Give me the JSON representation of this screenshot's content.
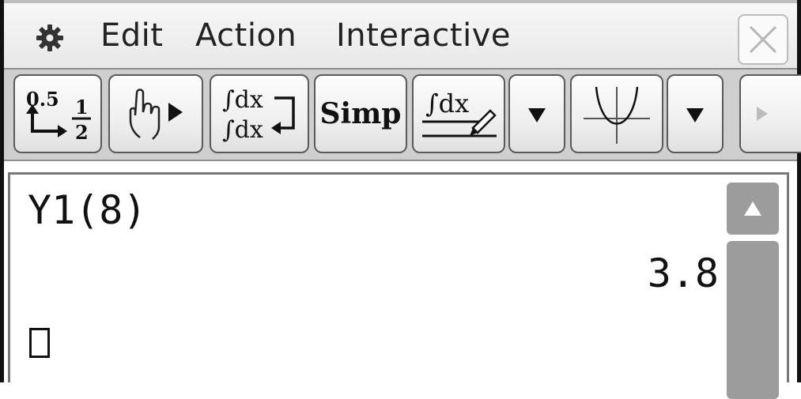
{
  "menubar": {
    "items": [
      {
        "label": "Edit"
      },
      {
        "label": "Action"
      },
      {
        "label": "Interactive"
      }
    ],
    "icons": {
      "settings": "gear-icon",
      "close": "close-icon"
    }
  },
  "toolbar": {
    "buttons": [
      {
        "icon": "decimal-fraction-toggle-icon",
        "top_text": "0.5",
        "fraction_num": "1",
        "fraction_den": "2"
      },
      {
        "icon": "hand-pointer-play-icon"
      },
      {
        "icon": "integral-exact-approx-icon",
        "line1": "∫dx",
        "line2": "∫dx"
      },
      {
        "label": "Simp"
      },
      {
        "icon": "integral-pen-icon",
        "line1": "∫dx"
      },
      {
        "icon": "dropdown-arrow-icon"
      },
      {
        "icon": "graph-parabola-icon"
      },
      {
        "icon": "dropdown-arrow-icon"
      },
      {
        "icon": "play-arrow-icon"
      }
    ]
  },
  "work": {
    "expression": "Y1(8)",
    "result": "3.8"
  },
  "colors": {
    "menubar_bg": "#efefef",
    "toolbar_bg": "#cfcfcf",
    "scrollbar": "#9c9c9c"
  }
}
